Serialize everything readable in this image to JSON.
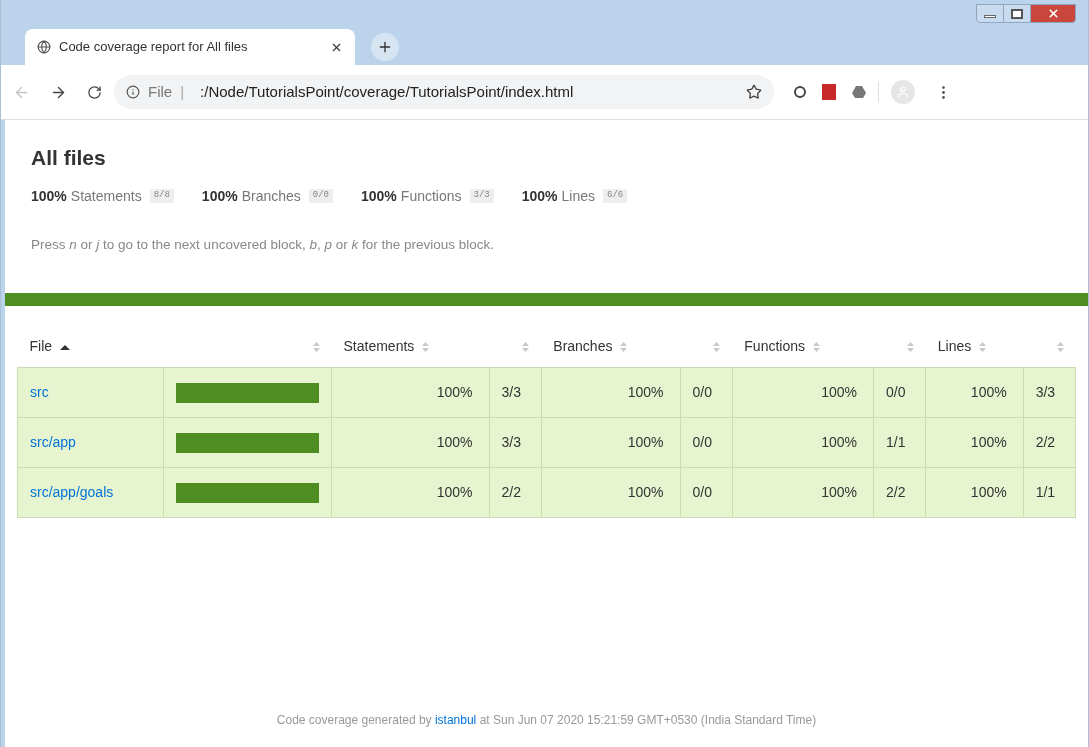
{
  "window": {
    "tab_title": "Code coverage report for All files",
    "url_scheme": "File",
    "url_separator": "|",
    "url": ":/Node/TutorialsPoint/coverage/TutorialsPoint/index.html",
    "back_disabled": true
  },
  "heading": "All files",
  "summary": [
    {
      "pct": "100%",
      "label": "Statements",
      "fraction": "8/8"
    },
    {
      "pct": "100%",
      "label": "Branches",
      "fraction": "0/0"
    },
    {
      "pct": "100%",
      "label": "Functions",
      "fraction": "3/3"
    },
    {
      "pct": "100%",
      "label": "Lines",
      "fraction": "6/6"
    }
  ],
  "help": "Press *n* or *j* to go to the next uncovered block, *b*, *p* or *k* for the previous block.",
  "table": {
    "columns": [
      {
        "label": "File",
        "sorted": true
      },
      {
        "sorted": false
      },
      {
        "label": "Statements",
        "sorted": false
      },
      {
        "sorted": false
      },
      {
        "label": "Branches",
        "sorted": false
      },
      {
        "sorted": false
      },
      {
        "label": "Functions",
        "sorted": false
      },
      {
        "sorted": false
      },
      {
        "label": "Lines",
        "sorted": false
      },
      {
        "sorted": false
      }
    ],
    "rows": [
      {
        "level": 1,
        "cells": [
          "src",
          "",
          "100%",
          "3/3",
          "100%",
          "0/0",
          "100%",
          "0/0",
          "100%",
          "3/3"
        ]
      },
      {
        "level": 1,
        "cells": [
          "src/app",
          "",
          "100%",
          "3/3",
          "100%",
          "0/0",
          "100%",
          "1/1",
          "100%",
          "2/2"
        ]
      },
      {
        "level": 1,
        "cells": [
          "src/app/goals",
          "",
          "100%",
          "2/2",
          "100%",
          "0/0",
          "100%",
          "2/2",
          "100%",
          "1/1"
        ]
      }
    ]
  },
  "footer": {
    "before": "Code coverage generated by",
    "link": "istanbul",
    "after": "at Sun Jun 07 2020 15:21:59 GMT+0530 (India Standard Time)"
  }
}
